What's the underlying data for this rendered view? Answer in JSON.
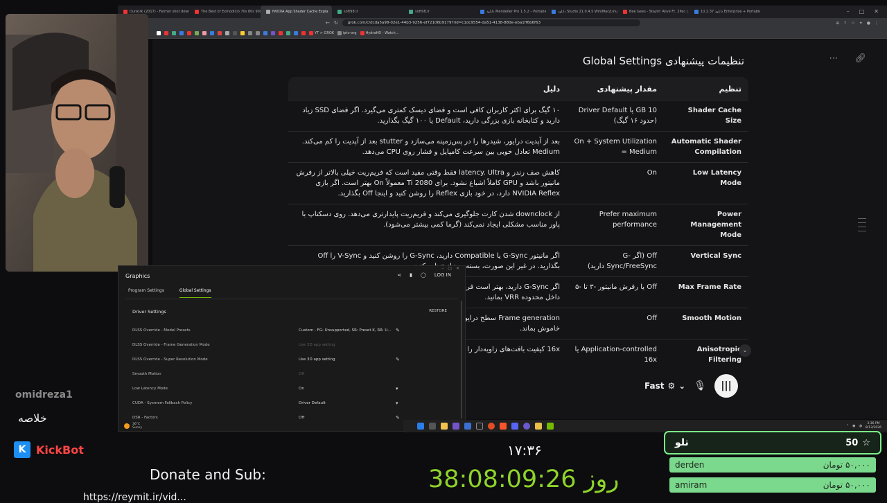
{
  "browser": {
    "tabs": [
      {
        "label": "Dunkirk (2017) - Farmer shot down C"
      },
      {
        "label": "The Best of Exmodicio 70s 80s 90s"
      },
      {
        "label": "NVIDIA App Shader Cache Expla",
        "active": true
      },
      {
        "label": "soft98.ir"
      },
      {
        "label": "soft98.ir"
      },
      {
        "label": "دانلود Mendeller Pro 1.5.2 – Portable"
      },
      {
        "label": "دانلود Studio 21.0.4.5 Win/Mac/Linux"
      },
      {
        "label": "Bee Gees - Stayin' Alive Ft. 2Pac | Ja"
      },
      {
        "label": "دانلود 10.2.37 Enterprise + Portable"
      }
    ],
    "url": "grok.com/c/dcda5a98-02e1-44b3-9256-ef72106b9179?rid=c1dc9554-da51-4138-880e-eba1ff6b6f63",
    "bookmarks": [
      "YT > GROK",
      "iptv-org",
      "HydraHD - Watch..."
    ]
  },
  "page": {
    "heading": "تنظیمات پیشنهادی Global Settings",
    "table": {
      "headers": [
        "تنظیم",
        "مقدار پیشنهادی",
        "دلیل"
      ],
      "rows": [
        {
          "setting": "Shader Cache Size",
          "value": "10 GB یا Driver Default (حدود ۱۶ گیگ)",
          "reason": "۱۰ گیگ برای اکثر کاربران کافی است و فضای دیسک کمتری می‌گیرد. اگر فضای SSD زیاد دارید و کتابخانه بازی بزرگی دارید، Default یا ۱۰۰ گیگ بگذارید."
        },
        {
          "setting": "Automatic Shader Compilation",
          "value": "On + System Utilization = Medium",
          "reason": "بعد از آپدیت درایور، شیدرها را در پس‌زمینه می‌سازد و stutter بعد از آپدیت را کم می‌کند. Medium تعادل خوبی بین سرعت کامپایل و فشار روی CPU می‌دهد."
        },
        {
          "setting": "Low Latency Mode",
          "value": "On",
          "reason": "کاهش صف رندر و latency. Ultra فقط وقتی مفید است که فریم‌ریت خیلی بالاتر از رفرش مانیتور باشد و GPU کاملاً اشباع نشود. برای 2080 Ti معمولاً On بهتر است. اگر بازی NVIDIA Reflex دارد، در خود بازی Reflex را روشن کنید و اینجا Off بگذارید."
        },
        {
          "setting": "Power Management Mode",
          "value": "Prefer maximum performance",
          "reason": "از downclock شدن کارت جلوگیری می‌کند و فریم‌ریت پایدارتری می‌دهد. روی دسکتاپ با پاور مناسب مشکلی ایجاد نمی‌کند (گرما کمی بیشتر می‌شود)."
        },
        {
          "setting": "Vertical Sync",
          "value": "Off (اگر G-Sync/FreeSync دارید)",
          "reason": "اگر مانیتور G-Sync یا Compatible دارید، G-Sync را روشن کنید و V-Sync را Off بگذارید. در غیر این صورت، بسته به نیاز تنظیم کنید."
        },
        {
          "setting": "Max Frame Rate",
          "value": "Off یا رفرش مانیتور -۳ تا -۵",
          "reason": "اگر G-Sync دارید، بهتر است فریم‌ریت را کمی زیر رفرش مانیتور محدود کنید تا همیشه داخل محدوده VRR بمانید."
        },
        {
          "setting": "Smooth Motion",
          "value": "Off",
          "reason": "Frame generation سطح درایور است و ممکن است تأخیر اضافه کند؛ برای واکنش‌محور خاموش بماند."
        },
        {
          "setting": "Anisotropic Filtering",
          "value": "Application-controlled یا 16x",
          "reason": "16x کیفیت بافت‌های زاویه‌دار را بهتر می‌کند و هزینه کمی دارد."
        }
      ]
    },
    "composer": {
      "model": "Fast"
    }
  },
  "nvidia_app": {
    "title": "Graphics",
    "login": "LOG IN",
    "tabs": [
      "Program Settings",
      "Global Settings"
    ],
    "section": "Driver Settings",
    "restore": "RESTORE",
    "settings": [
      {
        "label": "DLSS Override - Model Presets",
        "value": "Custom - FG: Unsupported, SR: Preset K, RR: U...",
        "dim": false,
        "action": "edit"
      },
      {
        "label": "DLSS Override - Frame Generation Mode",
        "value": "Use 3D app setting",
        "dim": true,
        "action": ""
      },
      {
        "label": "DLSS Override - Super Resolution Mode",
        "value": "Use 3D app setting",
        "dim": false,
        "action": "edit"
      },
      {
        "label": "Smooth Motion",
        "value": "Off",
        "dim": true,
        "action": ""
      },
      {
        "label": "Low Latency Mode",
        "value": "On",
        "dim": false,
        "action": "dropdown"
      },
      {
        "label": "CUDA - Sysmem Fallback Policy",
        "value": "Driver Default",
        "dim": false,
        "action": "dropdown"
      },
      {
        "label": "DSR - Factors",
        "value": "Off",
        "dim": false,
        "action": "edit"
      }
    ],
    "weather_temp": "36°C",
    "weather_desc": "Sunny"
  },
  "taskbar": {
    "time": "3:36 PM",
    "date": "8/13/2026"
  },
  "overlay": {
    "chat_user": "omidreza1",
    "chat_message": "خلاصه",
    "bot_name": "KickBot",
    "donate_text": "Donate and Sub:",
    "donate_url": "https://reymit.ir/vid...",
    "clock": "۱۷:۳۶",
    "timer": "38:08:09:26 روز"
  },
  "donations": {
    "title": "تلو",
    "count": "50",
    "entries": [
      {
        "name": "derden",
        "amount": "۵۰,۰۰۰ تومان"
      },
      {
        "name": "amiram",
        "amount": "۵۰,۰۰۰ تومان"
      }
    ]
  },
  "colors": {
    "nvidia_green": "#76b900",
    "timer_green": "#8ed42a",
    "kick_red": "#ff4545",
    "donation_green": "#7bd98d"
  }
}
